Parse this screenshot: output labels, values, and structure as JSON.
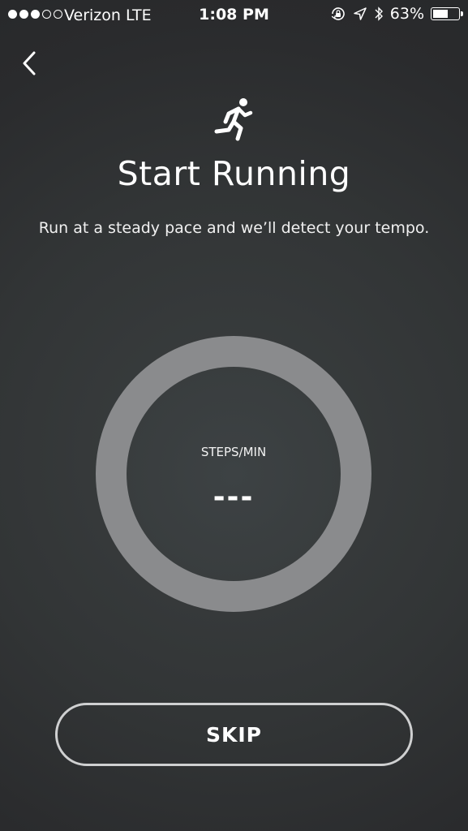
{
  "status_bar": {
    "signal_filled": 3,
    "signal_total": 5,
    "carrier": "Verizon",
    "network": "LTE",
    "time": "1:08 PM",
    "battery_percent": "63%",
    "battery_level": 0.63,
    "icons": [
      "orientation-lock-icon",
      "location-arrow-icon",
      "bluetooth-icon",
      "battery-icon"
    ]
  },
  "nav": {
    "back_icon": "chevron-left-icon"
  },
  "header": {
    "icon": "running-person-icon",
    "title": "Start Running",
    "subtitle": "Run at a steady pace and we’ll detect your tempo."
  },
  "tempo": {
    "label": "STEPS/MIN",
    "value": "---"
  },
  "actions": {
    "skip_label": "SKIP"
  },
  "colors": {
    "background": "#2f3233",
    "ring": "#8a8b8d",
    "text": "#ffffff",
    "button_border": "#cfd0d1"
  }
}
